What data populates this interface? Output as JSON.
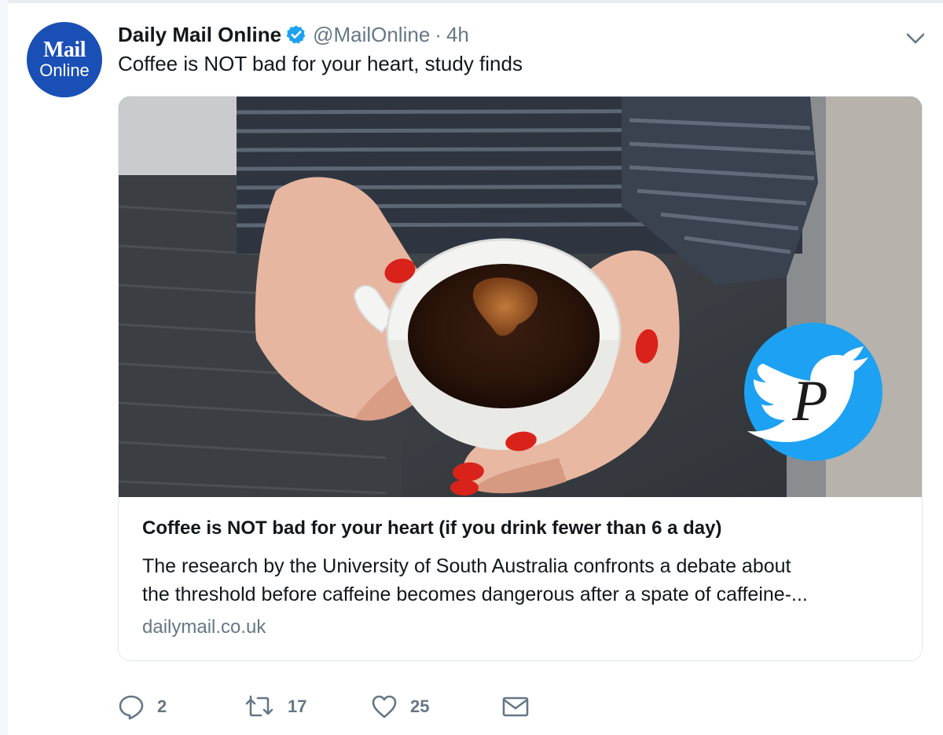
{
  "tweet": {
    "avatar": {
      "line1": "Mail",
      "line2": "Online",
      "bg_color": "#1a4fb5"
    },
    "author_name": "Daily Mail Online",
    "verified_icon": "verified-badge-icon",
    "handle": "@MailOnline",
    "separator": "·",
    "time": "4h",
    "menu_icon": "chevron-down-icon",
    "text": "Coffee is NOT bad for your heart, study finds"
  },
  "card": {
    "image_description_icon": "coffee-cup-photo",
    "overlay_icon": "twitter-bird-icon",
    "overlay_letter": "P",
    "title": "Coffee is NOT bad for your heart (if you drink fewer than 6 a day)",
    "description_lines": [
      "The research by the University of South Australia confronts a debate about",
      "the threshold before caffeine becomes dangerous after a spate of caffeine-..."
    ],
    "domain": "dailymail.co.uk"
  },
  "actions": {
    "reply": {
      "icon": "reply-icon",
      "count": "2"
    },
    "retweet": {
      "icon": "retweet-icon",
      "count": "17"
    },
    "like": {
      "icon": "heart-icon",
      "count": "25"
    },
    "message": {
      "icon": "envelope-icon"
    }
  },
  "colors": {
    "accent": "#1da1f2",
    "text": "#14171a",
    "muted": "#657786",
    "border": "#e1e8ed"
  }
}
